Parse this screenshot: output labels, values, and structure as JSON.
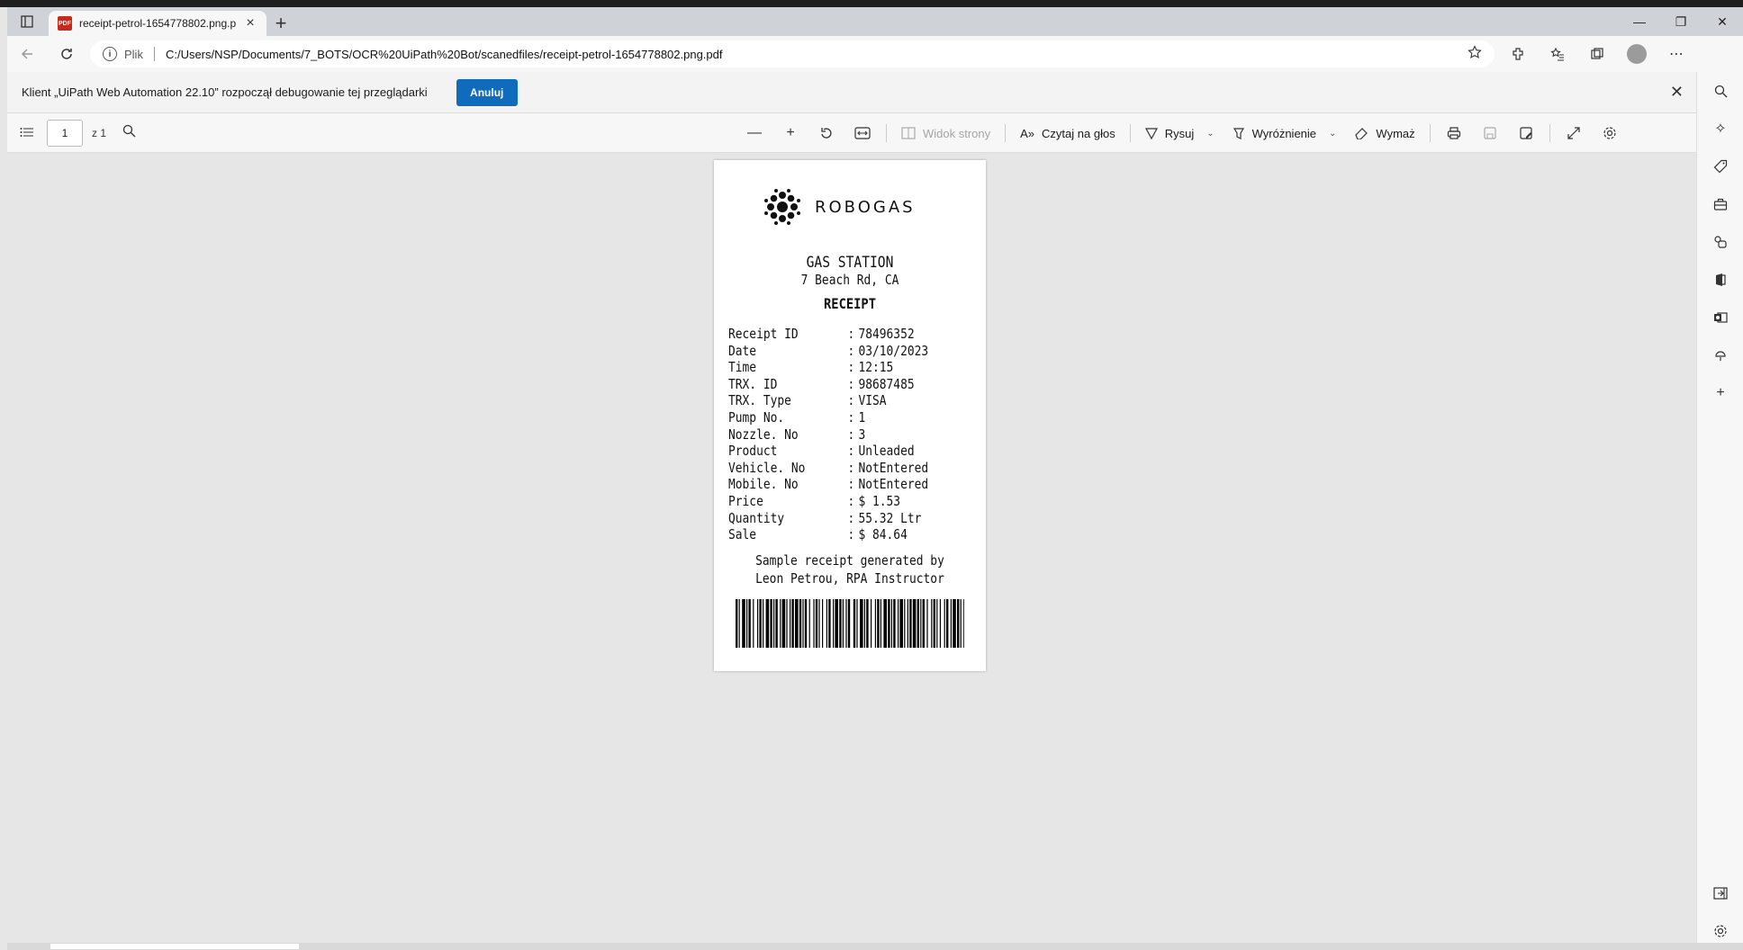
{
  "browser": {
    "tab_title": "receipt-petrol-1654778802.png.p",
    "tab_close": "×",
    "new_tab": "+",
    "window_controls": [
      "—",
      "❐",
      "✕"
    ],
    "address": {
      "info_label": "Plik",
      "url": "C:/Users/NSP/Documents/7_BOTS/OCR%20UiPath%20Bot/scanedfiles/receipt-petrol-1654778802.png.pdf"
    }
  },
  "infobar": {
    "message": "Klient „UiPath Web Automation 22.10” rozpoczął debugowanie tej przeglądarki",
    "cancel_label": "Anuluj"
  },
  "pdf_toolbar": {
    "page_number": "1",
    "page_count": "z 1",
    "page_view_label": "Widok strony",
    "read_aloud_label": "Czytaj na głos",
    "draw_label": "Rysuj",
    "highlight_label": "Wyróżnienie",
    "erase_label": "Wymaż"
  },
  "receipt": {
    "brand": "ROBOGAS",
    "station": "GAS STATION",
    "address": "7 Beach Rd, CA",
    "title": "RECEIPT",
    "rows": [
      {
        "key": "Receipt ID",
        "value": "78496352"
      },
      {
        "key": "Date",
        "value": "03/10/2023"
      },
      {
        "key": "Time",
        "value": "12:15"
      },
      {
        "key": "TRX. ID",
        "value": "98687485"
      },
      {
        "key": "TRX. Type",
        "value": "VISA"
      },
      {
        "key": "Pump No.",
        "value": "1"
      },
      {
        "key": "Nozzle. No",
        "value": "3"
      },
      {
        "key": "Product",
        "value": "Unleaded"
      },
      {
        "key": "Vehicle. No",
        "value": "NotEntered"
      },
      {
        "key": "Mobile. No",
        "value": "NotEntered"
      },
      {
        "key": "Price",
        "value": "$ 1.53"
      },
      {
        "key": "Quantity",
        "value": "55.32 Ltr"
      },
      {
        "key": "Sale",
        "value": "$ 84.64"
      }
    ],
    "footer_line1": "Sample receipt generated by",
    "footer_line2": "Leon Petrou, RPA Instructor"
  }
}
